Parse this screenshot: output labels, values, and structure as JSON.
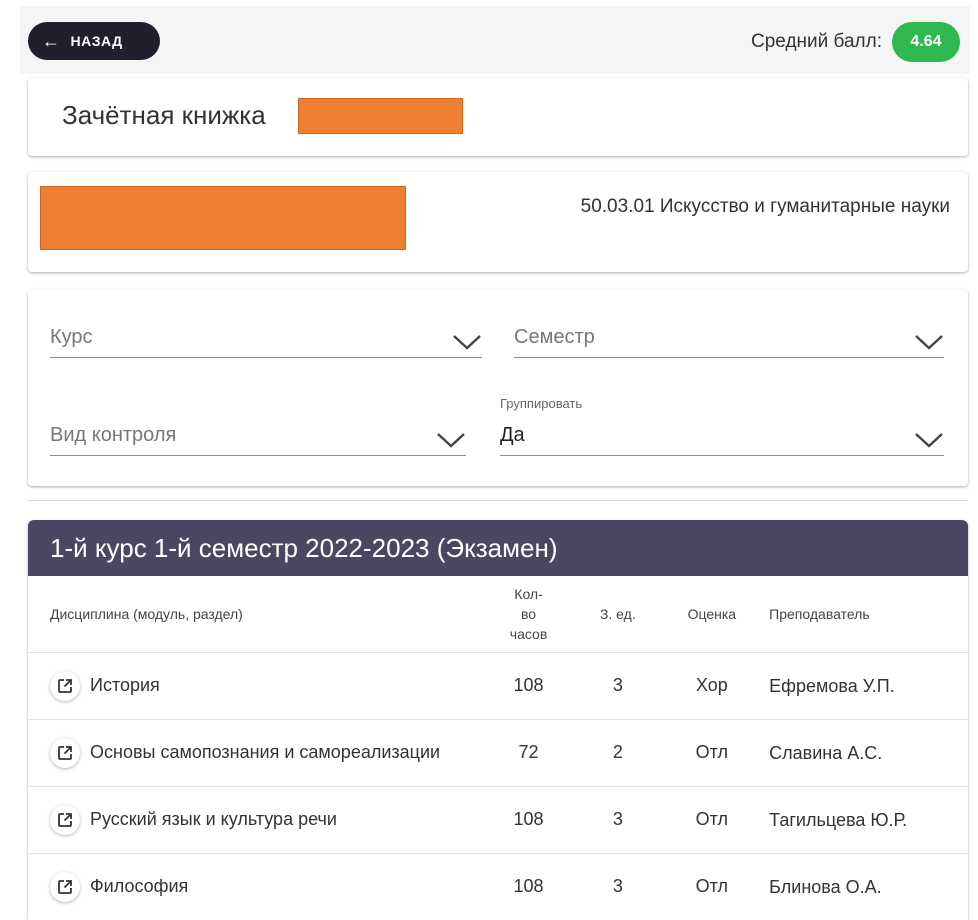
{
  "header": {
    "back_label": "НАЗАД",
    "avg_label": "Средний балл:",
    "avg_value": "4.64",
    "badge_color": "#2fb84f"
  },
  "gradebook": {
    "title": "Зачётная книжка"
  },
  "program": {
    "name": "50.03.01 Искусство и гуманитарные науки"
  },
  "filters": {
    "course_placeholder": "Курс",
    "semester_placeholder": "Семестр",
    "control_placeholder": "Вид контроля",
    "group_label": "Группировать",
    "group_value": "Да"
  },
  "section": {
    "title": "1-й курс 1-й семестр 2022-2023 (Экзамен)",
    "header_color": "#4b4762",
    "columns": {
      "discipline": "Дисциплина (модуль, раздел)",
      "hours": "Кол-\nво\nчасов",
      "credits": "З. ед.",
      "grade": "Оценка",
      "teacher": "Преподаватель"
    },
    "rows": [
      {
        "discipline": "История",
        "hours": "108",
        "credits": "3",
        "grade": "Хор",
        "teacher": "Ефремова У.П."
      },
      {
        "discipline": "Основы самопознания и самореализации",
        "hours": "72",
        "credits": "2",
        "grade": "Отл",
        "teacher": "Славина А.С."
      },
      {
        "discipline": "Русский язык и культура речи",
        "hours": "108",
        "credits": "3",
        "grade": "Отл",
        "teacher": "Тагильцева Ю.Р."
      },
      {
        "discipline": "Философия",
        "hours": "108",
        "credits": "3",
        "grade": "Отл",
        "teacher": "Блинова О.А."
      }
    ]
  },
  "redaction_color": "#ef8033"
}
